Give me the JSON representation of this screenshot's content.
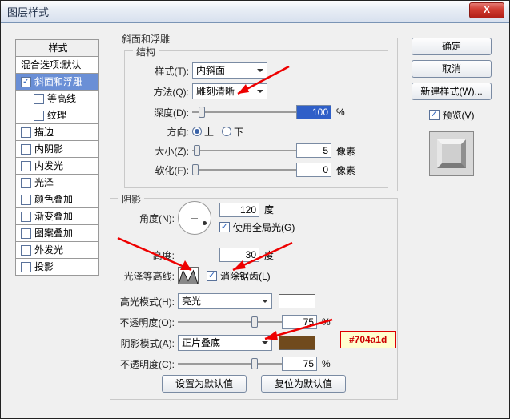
{
  "window": {
    "title": "图层样式"
  },
  "buttons": {
    "close_x": "X",
    "ok": "确定",
    "cancel": "取消",
    "new_style": "新建样式(W)...",
    "preview": "预览(V)",
    "set_default": "设置为默认值",
    "reset_default": "复位为默认值"
  },
  "styles_panel": {
    "header": "样式",
    "items": [
      {
        "id": "blend",
        "label": "混合选项:默认",
        "checked": null
      },
      {
        "id": "bevel",
        "label": "斜面和浮雕",
        "checked": true,
        "selected": true
      },
      {
        "id": "contour",
        "label": "等高线",
        "checked": false,
        "sub": true
      },
      {
        "id": "texture",
        "label": "纹理",
        "checked": false,
        "sub": true
      },
      {
        "id": "stroke",
        "label": "描边",
        "checked": false
      },
      {
        "id": "innershadow",
        "label": "内阴影",
        "checked": false
      },
      {
        "id": "innerglow",
        "label": "内发光",
        "checked": false
      },
      {
        "id": "satin",
        "label": "光泽",
        "checked": false
      },
      {
        "id": "coloroverlay",
        "label": "颜色叠加",
        "checked": false
      },
      {
        "id": "gradientoverlay",
        "label": "渐变叠加",
        "checked": false
      },
      {
        "id": "patternoverlay",
        "label": "图案叠加",
        "checked": false
      },
      {
        "id": "outerglow",
        "label": "外发光",
        "checked": false
      },
      {
        "id": "dropshadow",
        "label": "投影",
        "checked": false
      }
    ]
  },
  "bevel": {
    "title": "斜面和浮雕",
    "structure_title": "结构",
    "style_label": "样式(T):",
    "style_value": "内斜面",
    "technique_label": "方法(Q):",
    "technique_value": "雕刻清晰",
    "depth_label": "深度(D):",
    "depth_value": "100",
    "depth_unit": "%",
    "direction_label": "方向:",
    "direction_up": "上",
    "direction_down": "下",
    "size_label": "大小(Z):",
    "size_value": "5",
    "size_unit": "像素",
    "soften_label": "软化(F):",
    "soften_value": "0",
    "soften_unit": "像素"
  },
  "shading": {
    "title": "阴影",
    "angle_label": "角度(N):",
    "angle_value": "120",
    "angle_unit": "度",
    "use_global": "使用全局光(G)",
    "altitude_label": "高度:",
    "altitude_value": "30",
    "altitude_unit": "度",
    "gloss_contour_label": "光泽等高线:",
    "antialias_label": "消除锯齿(L)",
    "highlight_mode_label": "高光模式(H):",
    "highlight_mode_value": "亮光",
    "highlight_opacity_label": "不透明度(O):",
    "highlight_opacity_value": "75",
    "highlight_opacity_unit": "%",
    "shadow_mode_label": "阴影模式(A):",
    "shadow_mode_value": "正片叠底",
    "shadow_opacity_label": "不透明度(C):",
    "shadow_opacity_value": "75",
    "shadow_opacity_unit": "%"
  },
  "annotation": {
    "hex": "#704a1d"
  }
}
